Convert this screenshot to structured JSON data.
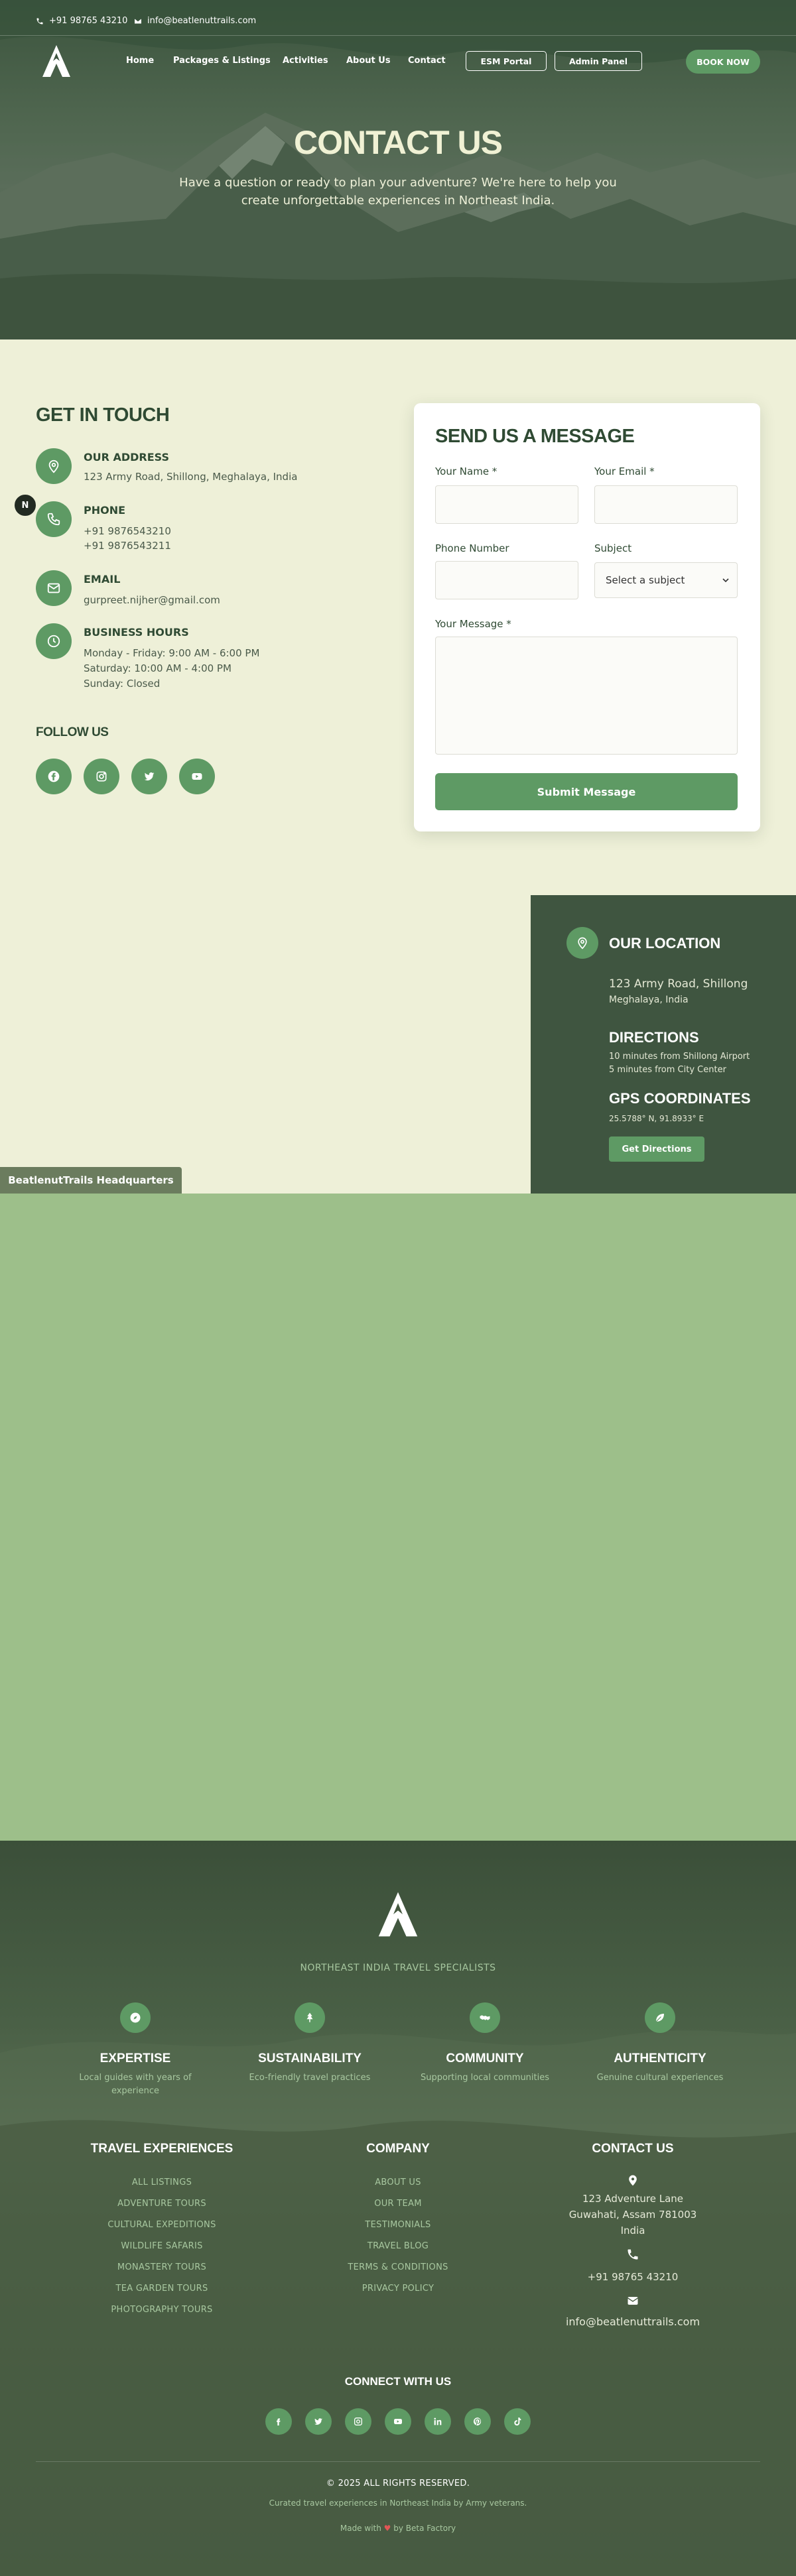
{
  "topbar": {
    "phone": "+91 98765 43210",
    "email": "info@beatlenuttrails.com"
  },
  "nav": {
    "links": [
      "Home",
      "Packages & Listings",
      "Activities",
      "About Us",
      "Contact"
    ],
    "esm_portal": "ESM Portal",
    "admin_panel": "Admin Panel",
    "book_now": "BOOK NOW"
  },
  "hero": {
    "title": "CONTACT US",
    "subtitle": "Have a question or ready to plan your adventure? We're here to help you create unforgettable experiences in Northeast India."
  },
  "contact_info": {
    "title": "GET IN TOUCH",
    "address_title": "OUR ADDRESS",
    "address": "123 Army Road, Shillong, Meghalaya, India",
    "phone_title": "PHONE",
    "phone_1": "+91 9876543210",
    "phone_2": "+91 9876543211",
    "email_title": "EMAIL",
    "email": "gurpreet.nijher@gmail.com",
    "hours_title": "BUSINESS HOURS",
    "hours_1": "Monday - Friday: 9:00 AM - 6:00 PM",
    "hours_2": "Saturday: 10:00 AM - 4:00 PM",
    "hours_3": "Sunday: Closed",
    "follow_title": "FOLLOW US",
    "float_badge": "N"
  },
  "form": {
    "title": "SEND US A MESSAGE",
    "name_label": "Your Name *",
    "name_value": "",
    "email_label": "Your Email *",
    "email_value": "",
    "phone_label": "Phone Number",
    "phone_value": "",
    "subject_label": "Subject",
    "subject_selected": "Select a subject",
    "message_label": "Your Message *",
    "message_value": "",
    "submit": "Submit Message"
  },
  "location": {
    "title": "OUR LOCATION",
    "address_1": "123 Army Road, Shillong",
    "address_2": "Meghalaya, India",
    "directions_title": "DIRECTIONS",
    "directions_1": "10 minutes from Shillong Airport",
    "directions_2": "5 minutes from City Center",
    "gps_title": "GPS COORDINATES",
    "gps": "25.5788° N, 91.8933° E",
    "button": "Get Directions",
    "hq_label": "BeatlenutTrails Headquarters"
  },
  "footer": {
    "tagline": "NORTHEAST INDIA TRAVEL SPECIALISTS",
    "features": [
      {
        "title": "EXPERTISE",
        "desc": "Local guides with years of experience"
      },
      {
        "title": "SUSTAINABILITY",
        "desc": "Eco-friendly travel practices"
      },
      {
        "title": "COMMUNITY",
        "desc": "Supporting local communities"
      },
      {
        "title": "AUTHENTICITY",
        "desc": "Genuine cultural experiences"
      }
    ],
    "travel_title": "TRAVEL EXPERIENCES",
    "travel_links": [
      "ALL LISTINGS",
      "ADVENTURE TOURS",
      "CULTURAL EXPEDITIONS",
      "WILDLIFE SAFARIS",
      "MONASTERY TOURS",
      "TEA GARDEN TOURS",
      "PHOTOGRAPHY TOURS"
    ],
    "company_title": "COMPANY",
    "company_links": [
      "ABOUT US",
      "OUR TEAM",
      "TESTIMONIALS",
      "TRAVEL BLOG",
      "TERMS & CONDITIONS",
      "PRIVACY POLICY"
    ],
    "contact_title": "CONTACT US",
    "contact_address_1": "123 Adventure Lane",
    "contact_address_2": "Guwahati, Assam 781003",
    "contact_address_3": "India",
    "contact_phone": "+91 98765 43210",
    "contact_email": "info@beatlenuttrails.com",
    "connect_title": "CONNECT WITH US",
    "copyright": "© 2025 ALL RIGHTS RESERVED.",
    "curated": "Curated travel experiences in Northeast India by Army veterans.",
    "made_prefix": "Made with",
    "made_suffix": "by Beta Factory"
  },
  "colors": {
    "accent": "#5e9a64",
    "dark_green": "#3f5540",
    "cream": "#eef0d8",
    "map_green": "#9dbf8a"
  }
}
